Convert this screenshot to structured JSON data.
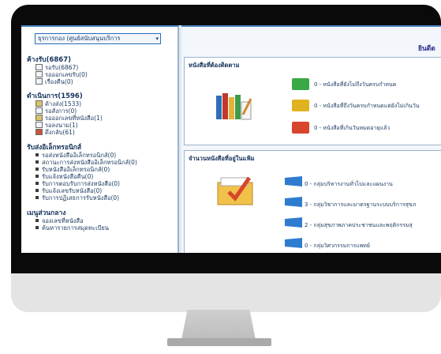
{
  "left": {
    "department_select": "ธุรการกอง (ศูนย์สนับสนุนบริการ",
    "sections": [
      {
        "title": "ค้างรับ(6867)",
        "items": [
          "รอรับ(6867)",
          "รอออกเลขรับ(0)",
          "เรื่องคืน(0)"
        ]
      },
      {
        "title": "ดำเนินการ(1596)",
        "items": [
          "ค้างส่ง(1533)",
          "รอสั่งการ(0)",
          "รอออกเลขที่หนังสือ(1)",
          "รอลงนาม(1)",
          "ดึงกลับ(61)"
        ]
      },
      {
        "title": "รับส่งอิเล็กทรอนิกส์",
        "items": [
          "รอส่งหนังสืออิเล็กทรอนิกส์(0)",
          "สถานะการส่งหนังสืออิเล็กทรอนิกส์(0)",
          "รับหนังสืออิเล็กทรอนิกส์(0)",
          "รับแจ้งหนังสือคืน(0)",
          "รับการตอบรับการส่งหนังสือ(0)",
          "รับแจ้งเลขรับหนังสือ(0)",
          "รับการปฏิเสธการรับหนังสือ(0)"
        ]
      },
      {
        "title": "เมนูส่วนกลาง",
        "items": [
          "จองเลขที่หนังสือ",
          "ค้นหารายการสมุดทะเบียน"
        ]
      }
    ]
  },
  "right": {
    "welcome": "ยินดีต",
    "followup": {
      "title": "หนังสือที่ต้องติดตาม",
      "rows": [
        "0 - หนังสือที่ยังไม่ถึงวันครบกำหนด",
        "0 - หนังสือที่ถึงวันครบกำหนดแต่ยังไม่เกินวัน",
        "0 - หนังสือที่เกินวันหมดอายุแล้ว"
      ],
      "colors": [
        "#3aa845",
        "#e0b21f",
        "#d8452d"
      ]
    },
    "folders": {
      "title": "จำนวนหนังสือที่อยู่ในแฟ้ม",
      "rows": [
        "0 - กลุ่มบริหารงานทั่วไปและแผนงาน",
        "3 - กลุ่มวิชาการและมาตรฐานระบบบริการสุขภ",
        "2 - กลุ่มสุขภาพภาคประชาชนและพฤติกรรมสุ",
        "0 - กลุ่มวิศวกรรมการแพทย์"
      ]
    }
  }
}
